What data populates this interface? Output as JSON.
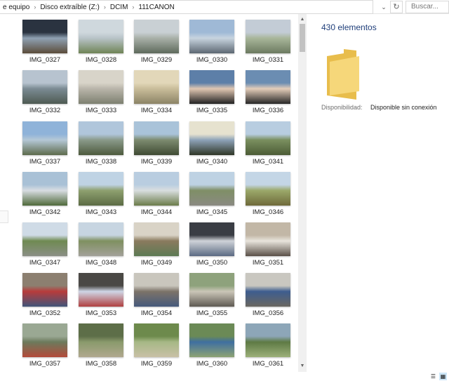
{
  "address": {
    "crumbs": [
      "e equipo",
      "Disco extraíble (Z:)",
      "DCIM",
      "111CANON"
    ],
    "separator": "›",
    "dropdown_glyph": "⌄",
    "refresh_glyph": "↻",
    "search_placeholder": "Buscar..."
  },
  "details": {
    "count_text": "430 elementos",
    "availability_label": "Disponibilidad:",
    "availability_value": "Disponible sin conexión",
    "folder_icon": "folder-icon"
  },
  "colors": {
    "folder_back": "#e8bd4c",
    "folder_front": "#f6d77a",
    "accent_text": "#1f3e7a",
    "view_active": "#cde6f7"
  },
  "files": [
    {
      "name": "IMG_0327",
      "colors": [
        "#2a3340",
        "#8fa1b3",
        "#5b4c3a"
      ]
    },
    {
      "name": "IMG_0328",
      "colors": [
        "#cfd8dd",
        "#b8c3c8",
        "#6f8456"
      ]
    },
    {
      "name": "IMG_0329",
      "colors": [
        "#c9d0d4",
        "#a9b0a8",
        "#5e6a5c"
      ]
    },
    {
      "name": "IMG_0330",
      "colors": [
        "#9fb9d6",
        "#c7d4df",
        "#5d6873"
      ]
    },
    {
      "name": "IMG_0331",
      "colors": [
        "#c3ccd6",
        "#a8b69a",
        "#6c7a60"
      ]
    },
    {
      "name": "IMG_0332",
      "colors": [
        "#b7c3cf",
        "#7b8b93",
        "#4e5a52"
      ]
    },
    {
      "name": "IMG_0333",
      "colors": [
        "#d8d4c9",
        "#b9b5aa",
        "#7d8070"
      ]
    },
    {
      "name": "IMG_0334",
      "colors": [
        "#e2d7b9",
        "#c9bd9a",
        "#8c8466"
      ]
    },
    {
      "name": "IMG_0335",
      "colors": [
        "#5d7fa8",
        "#e1c7b2",
        "#222222"
      ]
    },
    {
      "name": "IMG_0336",
      "colors": [
        "#6b8db2",
        "#e4cdb9",
        "#262626"
      ]
    },
    {
      "name": "IMG_0337",
      "colors": [
        "#8fb3d9",
        "#b5c8d6",
        "#5d6b4c"
      ]
    },
    {
      "name": "IMG_0338",
      "colors": [
        "#b0c6db",
        "#8a9a8a",
        "#4d5a3d"
      ]
    },
    {
      "name": "IMG_0339",
      "colors": [
        "#a9c3d9",
        "#7d8b70",
        "#3f4a33"
      ]
    },
    {
      "name": "IMG_0340",
      "colors": [
        "#e6e2cf",
        "#8ea3b8",
        "#2f3626"
      ]
    },
    {
      "name": "IMG_0341",
      "colors": [
        "#b8cde0",
        "#7a8f5f",
        "#4c5c36"
      ]
    },
    {
      "name": "IMG_0342",
      "colors": [
        "#a9c1d6",
        "#d8dde2",
        "#4f6a3a"
      ]
    },
    {
      "name": "IMG_0343",
      "colors": [
        "#bfd3e4",
        "#8ea06f",
        "#5b6b44"
      ]
    },
    {
      "name": "IMG_0344",
      "colors": [
        "#b9cde0",
        "#d9dedf",
        "#6b7c4a"
      ]
    },
    {
      "name": "IMG_0345",
      "colors": [
        "#bed2e3",
        "#7f8f66",
        "#8a8a82"
      ]
    },
    {
      "name": "IMG_0346",
      "colors": [
        "#c4d6e6",
        "#9ba86a",
        "#6f6a3a"
      ]
    },
    {
      "name": "IMG_0347",
      "colors": [
        "#cfdbe6",
        "#6f8a52",
        "#8b8f86"
      ]
    },
    {
      "name": "IMG_0348",
      "colors": [
        "#c7d5e1",
        "#7f9060",
        "#a3a19a"
      ]
    },
    {
      "name": "IMG_0349",
      "colors": [
        "#d9d3c6",
        "#8a7a5e",
        "#5d7a54"
      ]
    },
    {
      "name": "IMG_0350",
      "colors": [
        "#3a3d44",
        "#cfd3d8",
        "#5b6a83"
      ]
    },
    {
      "name": "IMG_0351",
      "colors": [
        "#c2b7a6",
        "#e8e4dc",
        "#5a5048"
      ]
    },
    {
      "name": "IMG_0352",
      "colors": [
        "#8c7f70",
        "#b83b3b",
        "#41557a"
      ]
    },
    {
      "name": "IMG_0353",
      "colors": [
        "#4a4845",
        "#cfd6e6",
        "#b04040"
      ]
    },
    {
      "name": "IMG_0354",
      "colors": [
        "#c9c6bd",
        "#7c7368",
        "#465a7c"
      ]
    },
    {
      "name": "IMG_0355",
      "colors": [
        "#8ea27c",
        "#cbc6b8",
        "#5e5a52"
      ]
    },
    {
      "name": "IMG_0356",
      "colors": [
        "#c9c7c0",
        "#3e5d8f",
        "#6a6760"
      ]
    },
    {
      "name": "IMG_0357",
      "colors": [
        "#9aa893",
        "#6c7a5c",
        "#b34a3a"
      ]
    },
    {
      "name": "IMG_0358",
      "colors": [
        "#5d6e48",
        "#8a9a6c",
        "#b0a88e"
      ]
    },
    {
      "name": "IMG_0359",
      "colors": [
        "#6d8a4c",
        "#a6b886",
        "#c9c0a6"
      ]
    },
    {
      "name": "IMG_0360",
      "colors": [
        "#6b8a56",
        "#3f6fa0",
        "#8ea373"
      ]
    },
    {
      "name": "IMG_0361",
      "colors": [
        "#8da6b8",
        "#5e7a44",
        "#9cb07a"
      ]
    }
  ]
}
